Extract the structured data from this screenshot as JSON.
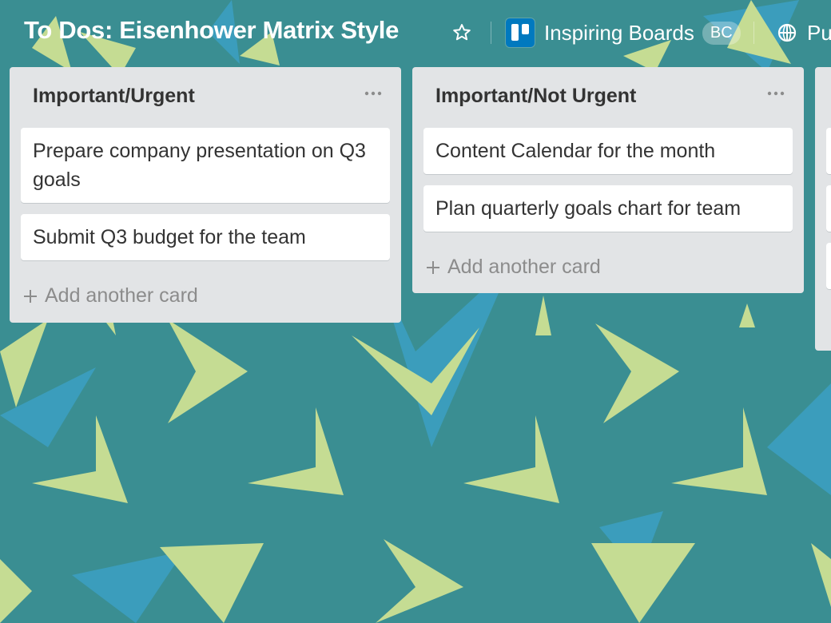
{
  "board": {
    "title": "To Dos: Eisenhower Matrix Style",
    "team_name": "Inspiring Boards",
    "team_badge": "BC",
    "visibility_label": "Pu",
    "background_color": "#3a8e92",
    "pattern_colors": [
      "#c5dc93",
      "#3c9fc1"
    ]
  },
  "lists": [
    {
      "title": "Important/Urgent",
      "cards": [
        "Prepare company presentation on Q3 goals",
        "Submit Q3 budget for the team"
      ],
      "add_card_label": "Add another card"
    },
    {
      "title": "Important/Not Urgent",
      "cards": [
        "Content Calendar for the month",
        "Plan quarterly goals chart for team"
      ],
      "add_card_label": "Add another card"
    }
  ]
}
